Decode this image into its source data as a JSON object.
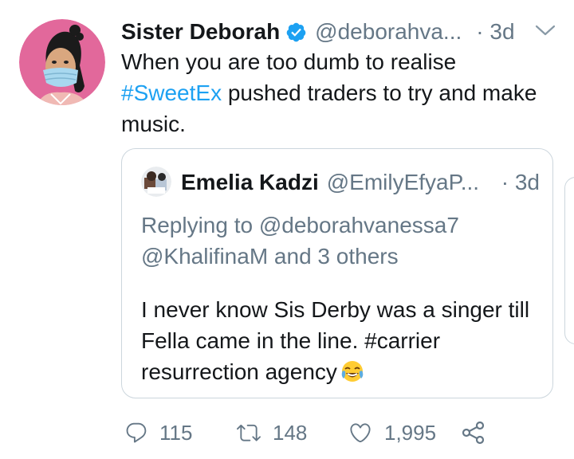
{
  "tweet": {
    "author_name": "Sister Deborah",
    "author_handle": "@deborahva...",
    "time": "· 3d",
    "avatar_icon": "avatar-woman-mask-icon",
    "verified_icon": "verified-badge-icon",
    "menu_icon": "chevron-down-icon",
    "text_part1": "When you are too dumb to realise",
    "hashtag": "#SweetEx",
    "text_part2": " pushed traders to try and make music."
  },
  "quote": {
    "author_name": "Emelia Kadzi",
    "author_handle": "@EmilyEfyaP...",
    "time": "· 3d",
    "avatar_icon": "avatar-photo-icon",
    "replying_line1": "Replying to @deborahvanessa7",
    "replying_line2": "@KhalifinaM and 3 others",
    "text": "I never know Sis Derby was a singer till Fella came in the line.  #carrier resurrection agency",
    "emoji": "face-with-tears-of-joy-emoji"
  },
  "actions": {
    "reply_count": "115",
    "retweet_count": "148",
    "like_count": "1,995",
    "reply_icon": "reply-bubble-icon",
    "retweet_icon": "retweet-icon",
    "like_icon": "heart-icon",
    "share_icon": "share-icon"
  },
  "colors": {
    "link": "#1da1f2",
    "secondary_text": "#657786",
    "border": "#ccd6dd",
    "avatar_bg": "#e2689b"
  }
}
